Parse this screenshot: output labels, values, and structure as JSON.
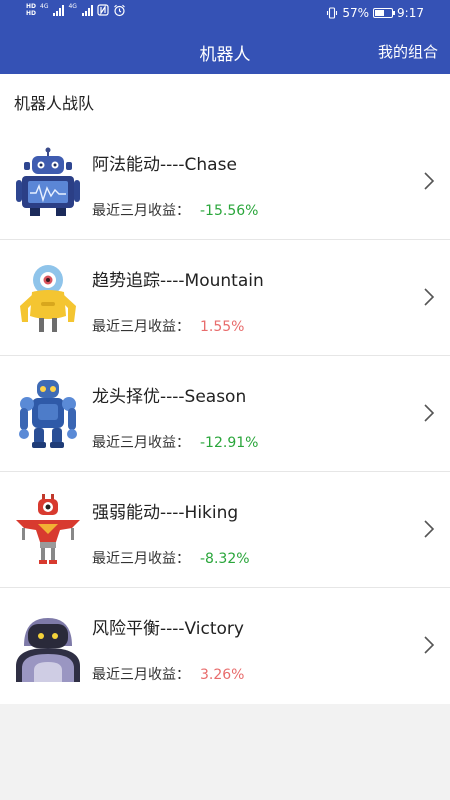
{
  "status_bar": {
    "net1": "4G",
    "net2": "4G",
    "hd": "HD",
    "battery": "57%",
    "battery_level": 0.57,
    "time": "9:17"
  },
  "nav": {
    "title": "机器人",
    "action": "我的组合"
  },
  "section_title": "机器人战队",
  "return_label": "最近三月收益：",
  "robots": [
    {
      "name": "阿法能动----Chase",
      "return": "-15.56%",
      "trend": "down",
      "icon": "robot-monitor-icon"
    },
    {
      "name": "趋势追踪----Mountain",
      "return": "1.55%",
      "trend": "up",
      "icon": "robot-cyclops-icon"
    },
    {
      "name": "龙头择优----Season",
      "return": "-12.91%",
      "trend": "down",
      "icon": "robot-blue-icon"
    },
    {
      "name": "强弱能动----Hiking",
      "return": "-8.32%",
      "trend": "down",
      "icon": "robot-red-icon"
    },
    {
      "name": "风险平衡----Victory",
      "return": "3.26%",
      "trend": "up",
      "icon": "robot-helmet-icon"
    }
  ],
  "colors": {
    "primary": "#3552b5",
    "negative": "#2aa63b",
    "positive": "#e86c6c"
  }
}
